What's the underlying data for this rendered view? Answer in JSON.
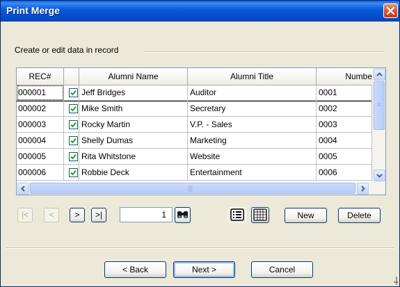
{
  "window": {
    "title": "Print Merge",
    "close_icon": "close-icon"
  },
  "group": {
    "label": "Create or edit data in record"
  },
  "grid": {
    "columns": [
      "REC#",
      "",
      "Alumni Name",
      "Alumni Title",
      "Numbe"
    ],
    "rows": [
      {
        "rec": "000001",
        "checked": true,
        "name": "Jeff Bridges",
        "title": "Auditor",
        "number": "0001"
      },
      {
        "rec": "000002",
        "checked": true,
        "name": "Mike Smith",
        "title": "Secretary",
        "number": "0002"
      },
      {
        "rec": "000003",
        "checked": true,
        "name": "Rocky Martin",
        "title": "V.P. - Sales",
        "number": "0003"
      },
      {
        "rec": "000004",
        "checked": true,
        "name": "Shelly Dumas",
        "title": "Marketing",
        "number": "0004"
      },
      {
        "rec": "000005",
        "checked": true,
        "name": "Rita Whitstone",
        "title": "Website",
        "number": "0005"
      },
      {
        "rec": "000006",
        "checked": true,
        "name": "Robbie Deck",
        "title": "Entertainment",
        "number": "0006"
      }
    ],
    "selected_row": 0
  },
  "navigator": {
    "first_label": "|<",
    "prev_label": "<",
    "next_label": ">",
    "last_label": ">|",
    "record_number": "1",
    "find_icon": "binoculars-icon",
    "list_view_icon": "list-view-icon",
    "grid_view_icon": "grid-view-icon",
    "new_label": "New",
    "delete_label": "Delete"
  },
  "footer": {
    "back_label": "< Back",
    "next_label": "Next >",
    "cancel_label": "Cancel"
  },
  "colors": {
    "title_bar": "#0A5CD8",
    "dialog_bg": "#ECE9D8",
    "close_button": "#D1532E",
    "checkbox_check": "#21A121"
  }
}
